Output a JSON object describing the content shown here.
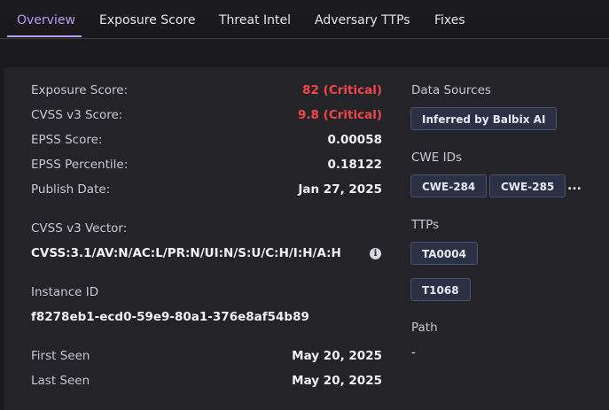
{
  "tabs": [
    {
      "label": "Overview",
      "active": true
    },
    {
      "label": "Exposure Score"
    },
    {
      "label": "Threat Intel"
    },
    {
      "label": "Adversary TTPs"
    },
    {
      "label": "Fixes"
    }
  ],
  "details": {
    "exposure_score": {
      "label": "Exposure Score:",
      "value": "82 (Critical)"
    },
    "cvss_score": {
      "label": "CVSS v3 Score:",
      "value": "9.8 (Critical)"
    },
    "epss_score": {
      "label": "EPSS Score:",
      "value": "0.00058"
    },
    "epss_percentile": {
      "label": "EPSS Percentile:",
      "value": "0.18122"
    },
    "publish_date": {
      "label": "Publish Date:",
      "value": "Jan 27, 2025"
    },
    "cvss_vector": {
      "label": "CVSS v3 Vector:",
      "value": "CVSS:3.1/AV:N/AC:L/PR:N/UI:N/S:U/C:H/I:H/A:H",
      "info_icon": "info-icon"
    },
    "instance_id": {
      "label": "Instance ID",
      "value": "f8278eb1-ecd0-59e9-80a1-376e8af54b89"
    },
    "first_seen": {
      "label": "First Seen",
      "value": "May 20, 2025"
    },
    "last_seen": {
      "label": "Last Seen",
      "value": "May 20, 2025"
    }
  },
  "sidebar": {
    "data_sources": {
      "label": "Data Sources",
      "chips": [
        "Inferred by Balbix AI"
      ]
    },
    "cwe_ids": {
      "label": "CWE IDs",
      "chips": [
        "CWE-284",
        "CWE-285"
      ],
      "more": "..."
    },
    "ttps": {
      "label": "TTPs",
      "chips": [
        "TA0004",
        "T1068"
      ]
    },
    "path": {
      "label": "Path",
      "value": "-"
    }
  },
  "colors": {
    "accent": "#b79cf4",
    "critical": "#ef4848",
    "chip_bg": "#2c3044",
    "panel_bg": "#242327"
  }
}
